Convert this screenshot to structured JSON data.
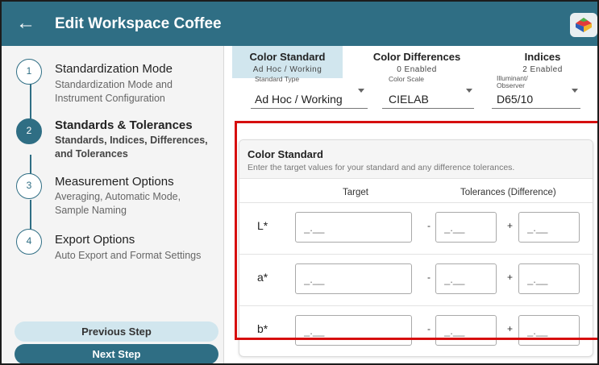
{
  "header": {
    "title": "Edit Workspace Coffee"
  },
  "steps": [
    {
      "number": "1",
      "title": "Standardization Mode",
      "subtitle": "Standardization Mode and Instrument Configuration"
    },
    {
      "number": "2",
      "title": "Standards & Tolerances",
      "subtitle": "Standards, Indices, Differences, and Tolerances"
    },
    {
      "number": "3",
      "title": "Measurement Options",
      "subtitle": "Averaging, Automatic Mode, Sample Naming"
    },
    {
      "number": "4",
      "title": "Export Options",
      "subtitle": "Auto Export and Format Settings"
    }
  ],
  "buttons": {
    "previous": "Previous Step",
    "next": "Next Step"
  },
  "tabs": [
    {
      "label": "Color Standard",
      "sub": "Ad Hoc / Working"
    },
    {
      "label": "Color Differences",
      "sub": "0 Enabled"
    },
    {
      "label": "Indices",
      "sub": "2 Enabled"
    }
  ],
  "dropdowns": {
    "standard_type": {
      "label": "Standard Type",
      "value": "Ad Hoc / Working"
    },
    "color_scale": {
      "label": "Color Scale",
      "value": "CIELAB"
    },
    "illuminant": {
      "label": "Illuminant/ Observer",
      "value": "D65/10"
    }
  },
  "card": {
    "title": "Color Standard",
    "description": "Enter the target values for your standard and any difference tolerances.",
    "col_target": "Target",
    "col_tolerances": "Tolerances (Difference)",
    "minus": "-",
    "plus": "+",
    "placeholder": "_.__",
    "rows": [
      {
        "label": "L*"
      },
      {
        "label": "a*"
      },
      {
        "label": "b*"
      }
    ]
  },
  "colors": {
    "primary": "#2f6e84",
    "tab_active": "#d1e6ee",
    "highlight": "#d60f0f"
  }
}
